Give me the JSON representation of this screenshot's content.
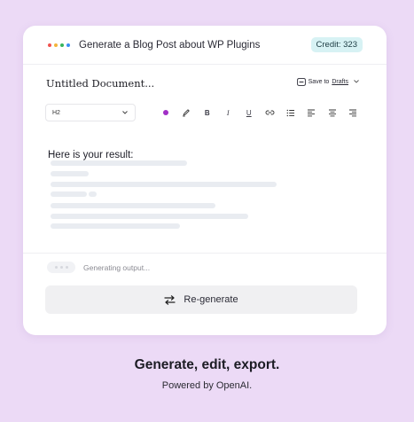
{
  "header": {
    "title": "Generate a Blog Post about WP Plugins",
    "credit": "Credit: 323",
    "dot_colors": [
      "#f0524f",
      "#f4b43a",
      "#35b45e",
      "#3b8df5"
    ]
  },
  "document": {
    "title": "Untitled Document...",
    "save_prefix": "Save to",
    "save_target": "Drafts"
  },
  "toolbar": {
    "heading_level": "H2",
    "text_color": "#a12fc6",
    "bold": "B",
    "italic": "I",
    "underline": "U"
  },
  "result": {
    "heading": "Here is your result:"
  },
  "status": {
    "text": "Generating output..."
  },
  "actions": {
    "regenerate_label": "Re-generate"
  },
  "footer": {
    "tagline": "Generate, edit, export.",
    "powered_by": "Powered by OpenAI."
  }
}
